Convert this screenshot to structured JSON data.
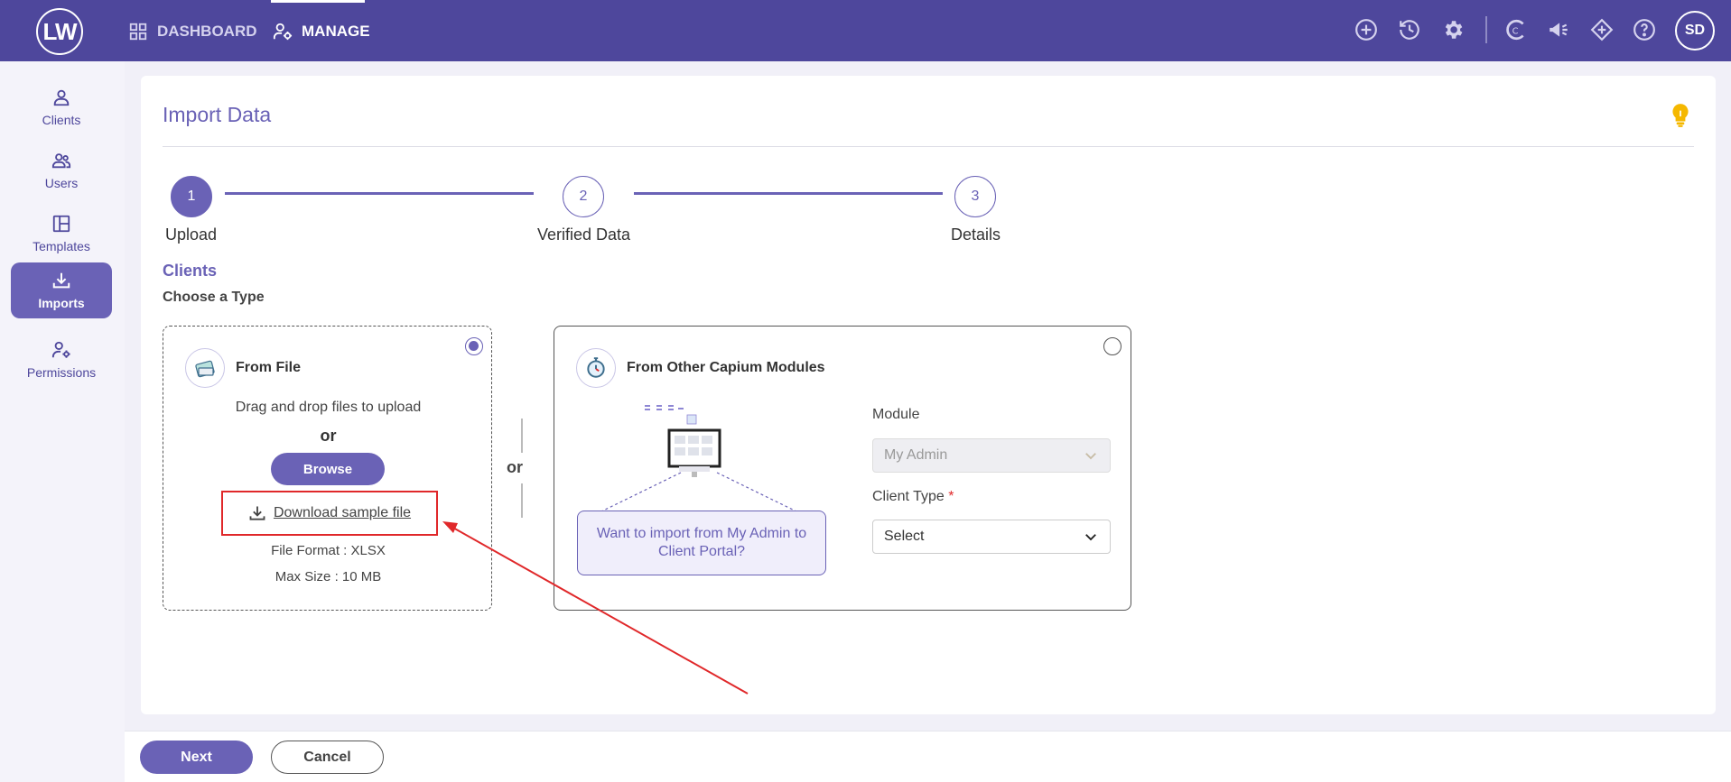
{
  "app": {
    "logo_text": "LW",
    "user_initials": "SD",
    "nav": [
      {
        "label": "DASHBOARD",
        "icon": "grid-icon"
      },
      {
        "label": "MANAGE",
        "icon": "users-gear-icon"
      }
    ],
    "top_icons": [
      "add-circle-icon",
      "history-icon",
      "settings-icon",
      "capium-icon",
      "megaphone-icon",
      "diamond-icon",
      "help-icon"
    ]
  },
  "sidebar": {
    "items": [
      {
        "label": "Clients",
        "icon": "person-icon"
      },
      {
        "label": "Users",
        "icon": "users-icon"
      },
      {
        "label": "Templates",
        "icon": "template-icon"
      },
      {
        "label": "Imports",
        "icon": "import-icon",
        "active": true
      },
      {
        "label": "Permissions",
        "icon": "permissions-icon"
      }
    ]
  },
  "page": {
    "title": "Import Data",
    "steps": [
      {
        "number": "1",
        "label": "Upload",
        "active": true
      },
      {
        "number": "2",
        "label": "Verified Data"
      },
      {
        "number": "3",
        "label": "Details"
      }
    ],
    "section_title": "Clients",
    "section_subtitle": "Choose a Type",
    "from_file": {
      "title": "From File",
      "drag_text": "Drag and drop files to upload",
      "or": "or",
      "browse": "Browse",
      "download": "Download sample file",
      "format": "File Format : XLSX",
      "max_size": "Max Size : 10 MB",
      "selected": true
    },
    "separator_or": "or",
    "from_other": {
      "title": "From Other Capium Modules",
      "bubble": "Want to import from My Admin to Client Portal?",
      "module_label": "Module",
      "module_value": "My Admin",
      "client_type_label": "Client Type",
      "required_mark": "*",
      "client_type_value": "Select",
      "selected": false
    }
  },
  "footer": {
    "next": "Next",
    "cancel": "Cancel"
  },
  "colors": {
    "primary": "#6a62b6",
    "header": "#4e479c",
    "annotation": "#e0282a"
  }
}
